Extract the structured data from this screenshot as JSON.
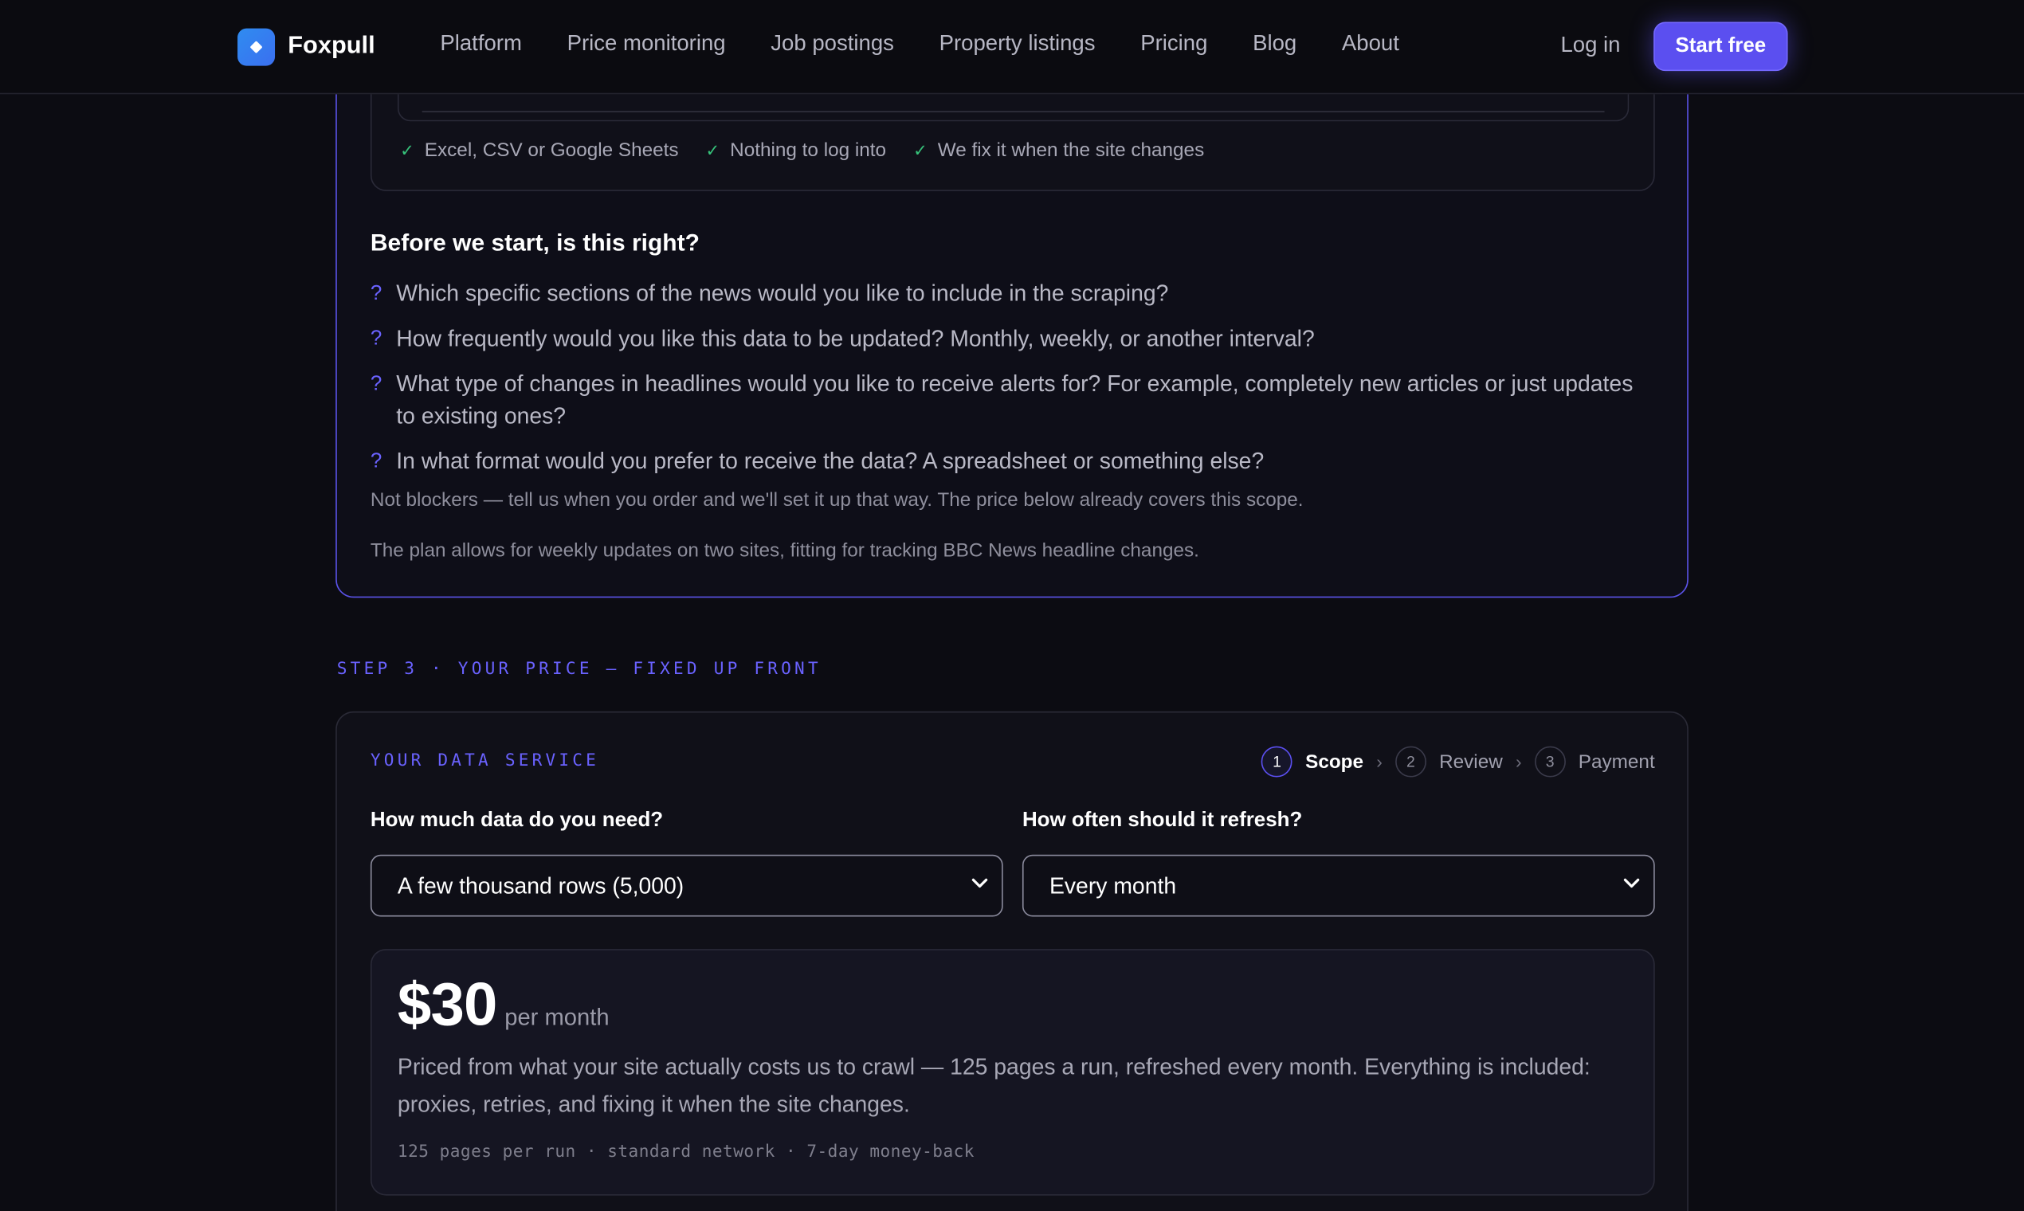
{
  "nav": {
    "brand": "Foxpull",
    "links": [
      "Platform",
      "Price monitoring",
      "Job postings",
      "Property listings",
      "Pricing",
      "Blog",
      "About"
    ],
    "login": "Log in",
    "cta": "Start free"
  },
  "review": {
    "checks": [
      "Excel, CSV or Google Sheets",
      "Nothing to log into",
      "We fix it when the site changes"
    ],
    "questions_title": "Before we start, is this right?",
    "questions": [
      "Which specific sections of the news would you like to include in the scraping?",
      "How frequently would you like this data to be updated? Monthly, weekly, or another interval?",
      "What type of changes in headlines would you like to receive alerts for? For example, completely new articles or just updates to existing ones?",
      "In what format would you prefer to receive the data? A spreadsheet or something else?"
    ],
    "question_mark": "?",
    "note_blockers": "Not blockers — tell us when you order and we'll set it up that way. The price below already covers this scope.",
    "note_plan": "The plan allows for weekly updates on two sites, fitting for tracking BBC News headline changes."
  },
  "step3": {
    "label": "STEP 3 · YOUR PRICE — FIXED UP FRONT",
    "service_label": "YOUR DATA SERVICE",
    "stepper": [
      {
        "num": "1",
        "label": "Scope",
        "active": true
      },
      {
        "num": "2",
        "label": "Review",
        "active": false
      },
      {
        "num": "3",
        "label": "Payment",
        "active": false
      }
    ],
    "data_label": "How much data do you need?",
    "data_value": "A few thousand rows (5,000)",
    "refresh_label": "How often should it refresh?",
    "refresh_value": "Every month",
    "price": "$30",
    "period": "per month",
    "description": "Priced from what your site actually costs us to crawl — 125 pages a run, refreshed every month. Everything is included: proxies, retries, and fixing it when the site changes.",
    "meta": "125 pages per run · standard network · 7-day money-back"
  },
  "colors": {
    "accent": "#5b4ff0",
    "accent_text": "#6a62ff",
    "check": "#36c27a",
    "background": "#0c0c12"
  },
  "icons": [
    "check-icon",
    "chevron-down-icon",
    "chevron-right-icon",
    "brand-logo-icon"
  ]
}
